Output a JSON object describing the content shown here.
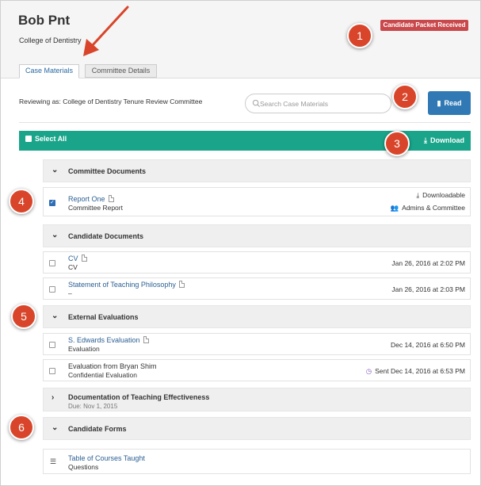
{
  "header": {
    "name": "Bob Pnt",
    "college": "College of Dentistry",
    "packet_badge": "Candidate Packet Received",
    "tabs": [
      {
        "label": "Case Materials"
      },
      {
        "label": "Committee Details"
      }
    ]
  },
  "toolbar": {
    "reviewing_as": "Reviewing as: College of Dentistry Tenure Review Committee",
    "search_placeholder": "Search Case Materials",
    "read_label": "Read"
  },
  "bulk": {
    "select_all_label": "Select All",
    "download_label": "Download"
  },
  "sections": {
    "committee": {
      "title": "Committee Documents",
      "items": [
        {
          "title": "Report One",
          "subtitle": "Committee Report",
          "meta1": "Downloadable",
          "meta2": "Admins & Committee"
        }
      ]
    },
    "candidate": {
      "title": "Candidate Documents",
      "items": [
        {
          "title": "CV",
          "subtitle": "CV",
          "date": "Jan 26, 2016 at 2:02 PM"
        },
        {
          "title": "Statement of Teaching Philosophy",
          "subtitle": "–",
          "date": "Jan 26, 2016 at 2:03 PM"
        }
      ]
    },
    "external": {
      "title": "External Evaluations",
      "items": [
        {
          "title": "S. Edwards Evaluation",
          "subtitle": "Evaluation",
          "date": "Dec 14, 2016 at 6:50 PM"
        },
        {
          "title": "Evaluation from Bryan Shim",
          "subtitle": "Confidential Evaluation",
          "date": "Sent Dec 14, 2016 at 6:53 PM"
        }
      ]
    },
    "teaching": {
      "title": "Documentation of Teaching Effectiveness",
      "due": "Due: Nov 1, 2015"
    },
    "forms": {
      "title": "Candidate Forms",
      "items": [
        {
          "title": "Table of Courses Taught",
          "subtitle": "Questions"
        }
      ]
    }
  },
  "callouts": [
    "1",
    "2",
    "3",
    "4",
    "5",
    "6"
  ],
  "colors": {
    "accent_green": "#1aa58a",
    "read_blue": "#3079b4",
    "badge_red": "#c9484b",
    "callout_red": "#d8452a",
    "link_blue": "#2b5f93"
  },
  "icons": {
    "read": "book-icon",
    "download": "download-icon",
    "search": "search-icon",
    "pdf": "pdf-icon",
    "users": "users-icon",
    "pending": "clock-icon",
    "list": "list-icon",
    "chevron_open": "chevron-down-icon",
    "chevron_closed": "chevron-right-icon"
  }
}
